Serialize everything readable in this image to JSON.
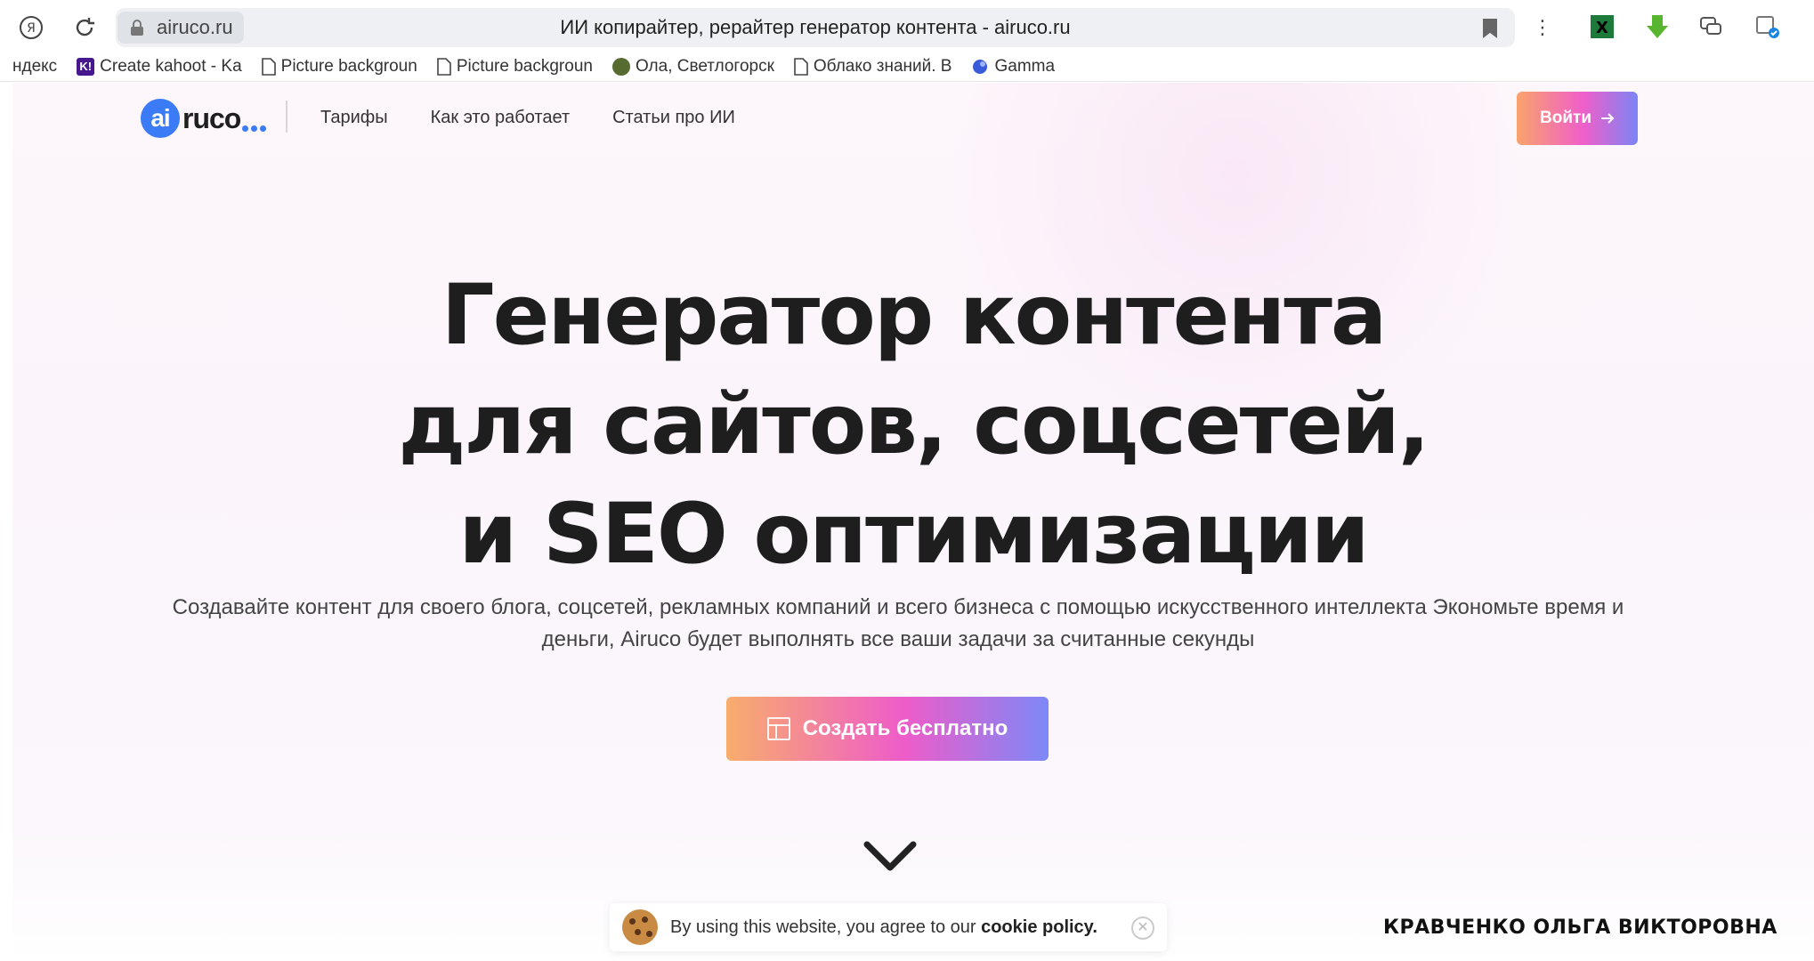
{
  "browser": {
    "url": "airuco.ru",
    "tab_title": "ИИ копирайтер, рерайтер генератор контента - airuco.ru",
    "bookmarks": [
      {
        "label": "ндекс",
        "icon": "yandex-icon"
      },
      {
        "label": "Create kahoot - Ka",
        "icon": "kahoot-icon"
      },
      {
        "label": "Picture backgroun",
        "icon": "page-icon"
      },
      {
        "label": "Picture backgroun",
        "icon": "page-icon"
      },
      {
        "label": "Ола, Светлогорск",
        "icon": "avatar-icon"
      },
      {
        "label": "Облако знаний. В",
        "icon": "page-icon"
      },
      {
        "label": "Gamma",
        "icon": "gamma-icon"
      }
    ]
  },
  "header": {
    "logo_ai": "ai",
    "logo_rest": "ruco",
    "nav": [
      "Тарифы",
      "Как это работает",
      "Статьи про ИИ"
    ],
    "login_label": "Войти"
  },
  "hero": {
    "title_line1": "Генератор контента",
    "title_line2": "для сайтов, соцсетей,",
    "title_line3": "и SEO оптимизации",
    "subtitle": "Создавайте контент для своего блога, соцсетей, рекламных компаний и всего бизнеса с помощью искусственного интеллекта Экономьте время и деньги, Airuco будет выполнять все ваши задачи за считанные секунды",
    "cta_label": "Создать бесплатно"
  },
  "cookie": {
    "text": "By using this website, you agree to our",
    "link": "cookie policy."
  },
  "watermark": "КРАВЧЕНКО ОЛЬГА ВИКТОРОВНА",
  "colors": {
    "accent_blue": "#3b7bf5",
    "gradient_start": "#f9a36b",
    "gradient_mid": "#ef5fc9",
    "gradient_end": "#7c84f6"
  }
}
